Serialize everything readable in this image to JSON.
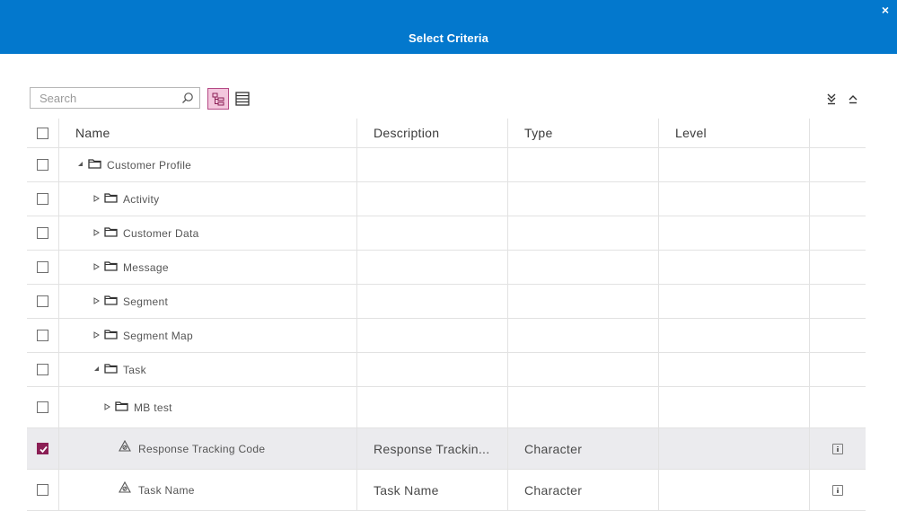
{
  "dialog": {
    "title": "Select Criteria",
    "close_label": "×"
  },
  "toolbar": {
    "search_placeholder": "Search",
    "search_value": ""
  },
  "grid": {
    "columns": [
      "Name",
      "Description",
      "Type",
      "Level"
    ],
    "rows": [
      {
        "name": "Customer Profile",
        "description": "",
        "type": "",
        "level": "",
        "kind": "folder",
        "expanded": true,
        "depth": 0,
        "checked": false
      },
      {
        "name": "Activity",
        "description": "",
        "type": "",
        "level": "",
        "kind": "folder",
        "expanded": false,
        "depth": 1,
        "checked": false
      },
      {
        "name": "Customer Data",
        "description": "",
        "type": "",
        "level": "",
        "kind": "folder",
        "expanded": false,
        "depth": 1,
        "checked": false
      },
      {
        "name": "Message",
        "description": "",
        "type": "",
        "level": "",
        "kind": "folder",
        "expanded": false,
        "depth": 1,
        "checked": false
      },
      {
        "name": "Segment",
        "description": "",
        "type": "",
        "level": "",
        "kind": "folder",
        "expanded": false,
        "depth": 1,
        "checked": false
      },
      {
        "name": "Segment Map",
        "description": "",
        "type": "",
        "level": "",
        "kind": "folder",
        "expanded": false,
        "depth": 1,
        "checked": false
      },
      {
        "name": "Task",
        "description": "",
        "type": "",
        "level": "",
        "kind": "folder",
        "expanded": true,
        "depth": 1,
        "checked": false
      },
      {
        "name": "MB test",
        "description": "",
        "type": "",
        "level": "",
        "kind": "folder",
        "expanded": false,
        "depth": 2,
        "checked": false
      },
      {
        "name": "Response Tracking Code",
        "description": "Response Trackin...",
        "type": "Character",
        "level": "",
        "kind": "field",
        "depth": 2,
        "checked": true
      },
      {
        "name": "Task Name",
        "description": "Task Name",
        "type": "Character",
        "level": "",
        "kind": "field",
        "depth": 2,
        "checked": false
      }
    ]
  },
  "colors": {
    "titlebar": "#0378cd",
    "accent": "#8b1f55",
    "selected_row": "#ebebee"
  }
}
